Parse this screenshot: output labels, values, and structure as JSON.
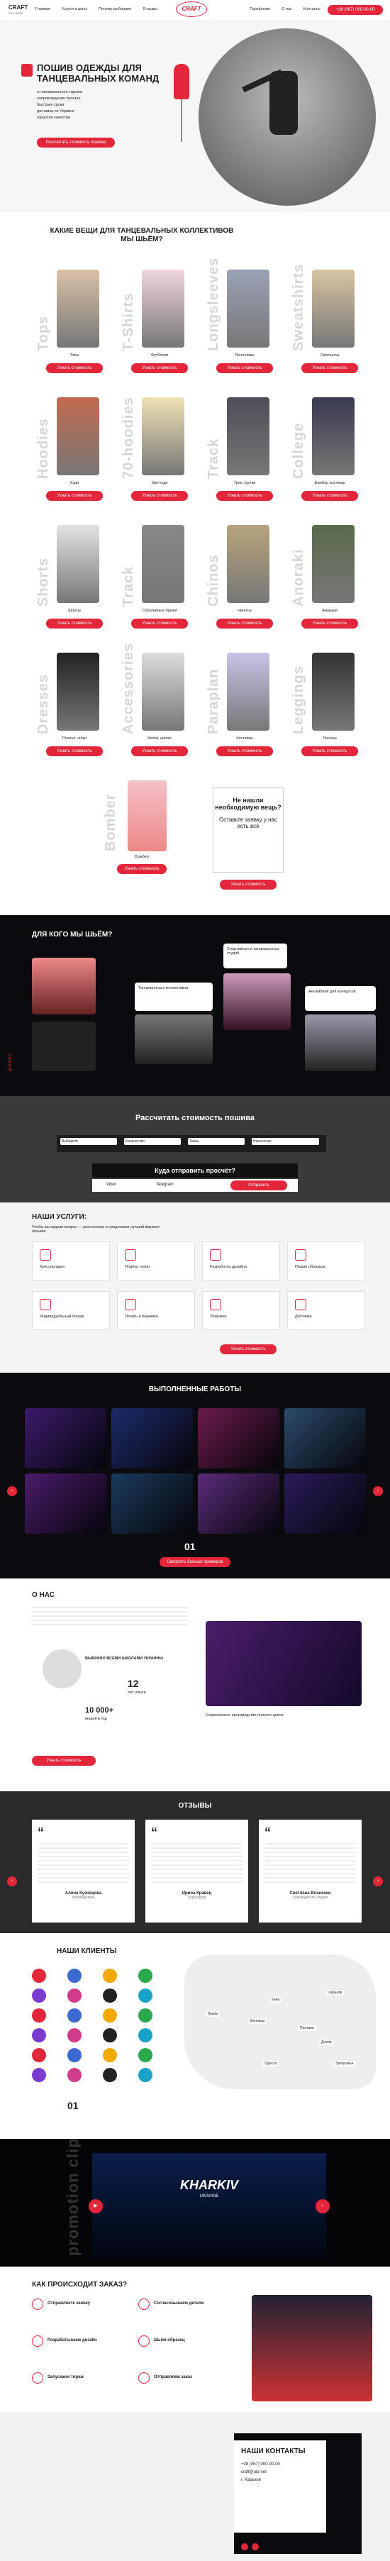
{
  "header": {
    "logo": "CRAFT",
    "tagline": "Мы шьём",
    "nav": [
      "Главная",
      "Услуги и цены",
      "Почему выбирают",
      "Отзывы"
    ],
    "nav_right": [
      "Портфолио",
      "О нас",
      "Контакты"
    ],
    "phone": "+38 (067) 000-00-00"
  },
  "hero": {
    "title": "ПОШИВ ОДЕЖДЫ ДЛЯ ТАНЦЕВАЛЬНЫХ КОМАНД",
    "bullets": [
      "от минимального тиража",
      "сопровождение проекта",
      "быстрые сроки",
      "доставка по Украине",
      "гарантия качества"
    ],
    "button": "Рассчитать стоимость пошива"
  },
  "what": {
    "title": "КАКИЕ ВЕЩИ ДЛЯ ТАНЦЕВАЛЬНЫХ КОЛЛЕКТИВОВ МЫ ШЬЁМ?",
    "btn": "Узнать стоимость",
    "items": [
      {
        "g": "Tops",
        "n": "Топы"
      },
      {
        "g": "T-Shirts",
        "n": "Футболки"
      },
      {
        "g": "Longsleeves",
        "n": "Лонгсливы"
      },
      {
        "g": "Sweatshirts",
        "n": "Свитшоты"
      },
      {
        "g": "Hoodies",
        "n": "Худи"
      },
      {
        "g": "70-hoodies",
        "n": "Зип-худи"
      },
      {
        "g": "Track",
        "n": "Трек. куртки"
      },
      {
        "g": "College",
        "n": "Бомбер колледж"
      },
      {
        "g": "Shorts",
        "n": "Шорты"
      },
      {
        "g": "Track",
        "n": "Спортивные брюки"
      },
      {
        "g": "Chinos",
        "n": "Чиносы"
      },
      {
        "g": "Anoraki",
        "n": "Анораки"
      },
      {
        "g": "Dresses",
        "n": "Платья, юбки"
      },
      {
        "g": "Accessories",
        "n": "Кепки, шапки"
      },
      {
        "g": "Paraplan",
        "n": "Костюмы"
      },
      {
        "g": "Leggings",
        "n": "Лосины"
      }
    ],
    "bomber": {
      "g": "Bomber",
      "n": "Бомбер"
    },
    "custom": {
      "t": "Не нашли необходимую вещь?",
      "s": "Оставьте заявку у нас есть всё",
      "b": "Узнать стоимость"
    }
  },
  "forwhom": {
    "title": "ДЛЯ КОГО МЫ ШЬЁМ?",
    "items": [
      "Спортивных и танцевальных студий",
      "Танцевальных коллективов",
      "Руководителей и хореографов",
      "Ансамблей для конкурсов"
    ]
  },
  "calc": {
    "title": "Рассчитать стоимость пошива",
    "fields": [
      "Выберите",
      "Количество",
      "Ткань",
      "Нанесение"
    ],
    "name_ph": "Имя",
    "phone_ph": "Телефон",
    "q": "Куда отправить просчёт?",
    "opts": [
      "Viber",
      "Telegram"
    ],
    "send": "Отправить"
  },
  "services": {
    "title": "НАШИ УСЛУГИ:",
    "intro": "Чтобы вы задали вопрос — рассчитаем и предложим лучший вариант пошива",
    "items": [
      "Консультация",
      "Подбор ткани",
      "Разработка дизайна",
      "Пошив образцов",
      "Индивидуальный пошив",
      "Печать и вышивка",
      "Упаковка",
      "Доставка"
    ],
    "btn": "Узнать стоимость"
  },
  "works": {
    "title": "ВЫПОЛНЕННЫЕ РАБОТЫ",
    "count": "01",
    "btn": "Смотреть больше примеров"
  },
  "about": {
    "title": "О НАС",
    "stat1": "12",
    "stat1t": "лет опыта",
    "stat2": "10 000+",
    "stat2t": "вещей в год",
    "badge": "ВЫБРАНО ВСЕМИ ШКОЛАМИ УКРАИНЫ",
    "text": "Современное производство полного цикла",
    "btn": "Узнать стоимость"
  },
  "reviews": {
    "title": "ОТЗЫВЫ",
    "items": [
      {
        "n": "Алина Кузнецова",
        "r": "Руководитель"
      },
      {
        "n": "Ирина Кравец",
        "r": "Хореограф"
      },
      {
        "n": "Светлана Власенко",
        "r": "Руководитель студии"
      }
    ]
  },
  "clients": {
    "title": "НАШИ КЛИЕНТЫ",
    "count": "01",
    "cities": [
      "Киев",
      "Харьков",
      "Одесса",
      "Днепр",
      "Львов",
      "Запорожье",
      "Винница",
      "Полтава"
    ]
  },
  "video": {
    "title": "KHARKIV",
    "sub": "UKRAINE",
    "ghost": "promotion clip"
  },
  "order": {
    "title": "КАК ПРОИСХОДИТ ЗАКАЗ?",
    "steps": [
      "Отправляете заявку",
      "Согласовываем детали",
      "Разрабатываем дизайн",
      "Шьём образец",
      "Запускаем тираж",
      "Отправляем заказ"
    ]
  },
  "contacts": {
    "title": "НАШИ КОНТАКТЫ",
    "phone": "+38 (067) 000-00-00",
    "email": "craft@ukr.net",
    "addr": "г. Харьков"
  },
  "colors": {
    "accent": "#e3263a",
    "dark": "#0b0b0f"
  }
}
